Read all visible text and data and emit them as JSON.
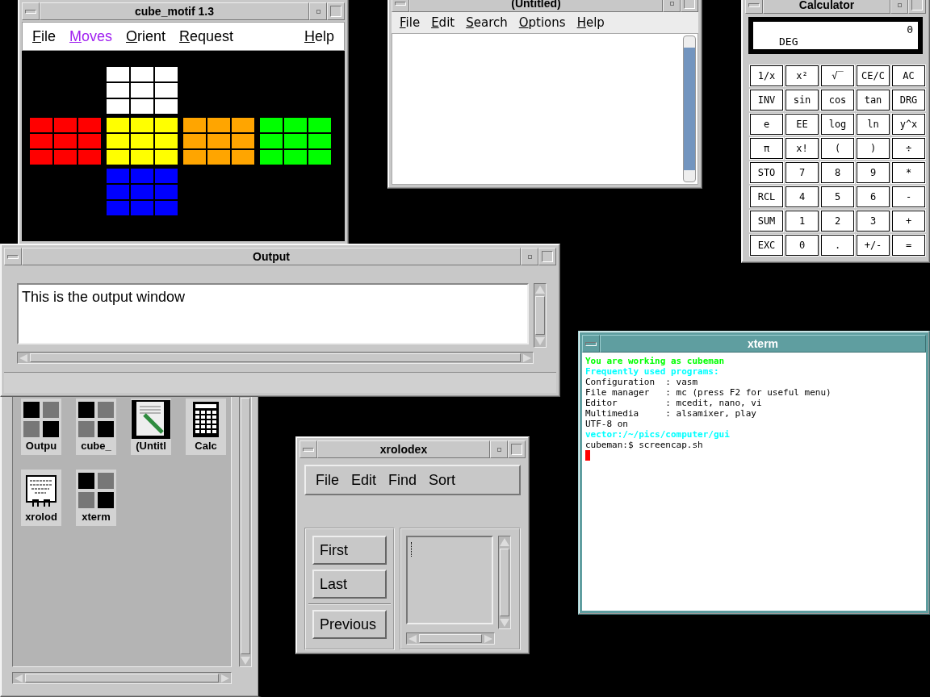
{
  "cube_window": {
    "title": "cube_motif 1.3",
    "menu": [
      {
        "label": "File",
        "selected": false
      },
      {
        "label": "Moves",
        "selected": true
      },
      {
        "label": "Orient",
        "selected": false
      },
      {
        "label": "Request",
        "selected": false
      },
      {
        "label": "Help",
        "selected": false
      }
    ],
    "faces": [
      {
        "color": "#ffffff"
      },
      {
        "color": "#ff0000"
      },
      {
        "color": "#ffff00"
      },
      {
        "color": "#ffa500"
      },
      {
        "color": "#00ff00"
      },
      {
        "color": "#0000ff"
      }
    ]
  },
  "editor_window": {
    "title": "(Untitled)",
    "menu": [
      "File",
      "Edit",
      "Search",
      "Options",
      "Help"
    ]
  },
  "calculator": {
    "title": "Calculator",
    "display": "0",
    "angle_mode": "DEG",
    "keys": [
      "1/x",
      "x²",
      "√‾",
      "CE/C",
      "AC",
      "INV",
      "sin",
      "cos",
      "tan",
      "DRG",
      "e",
      "EE",
      "log",
      "ln",
      "y^x",
      "π",
      "x!",
      "(",
      ")",
      "÷",
      "STO",
      "7",
      "8",
      "9",
      "*",
      "RCL",
      "4",
      "5",
      "6",
      "-",
      "SUM",
      "1",
      "2",
      "3",
      "+",
      "EXC",
      "0",
      ".",
      "+/-",
      "="
    ]
  },
  "output_window": {
    "title": "Output",
    "text": "This is the output window"
  },
  "icon_box": {
    "icons": [
      {
        "label": "Outpu",
        "kind": "window"
      },
      {
        "label": "cube_",
        "kind": "window"
      },
      {
        "label": "(Untitl",
        "kind": "editor"
      },
      {
        "label": "Calc",
        "kind": "calculator"
      },
      {
        "label": "xrolod",
        "kind": "rolodex"
      },
      {
        "label": "xterm",
        "kind": "window"
      }
    ]
  },
  "xterm": {
    "title": "xterm",
    "lines": [
      {
        "text": "You are working as cubeman",
        "color": "#00ff00",
        "kind": "banner"
      },
      {
        "text": "Frequently used programs:",
        "color": "#00ffff",
        "kind": "banner"
      },
      {
        "text": "Configuration  : vasm",
        "kind": "plain"
      },
      {
        "text": "File manager   : mc (press F2 for useful menu)",
        "kind": "plain"
      },
      {
        "text": "Editor         : mcedit, nano, vi",
        "kind": "plain"
      },
      {
        "text": "Multimedia     : alsamixer, play",
        "kind": "plain"
      },
      {
        "text": "UTF-8 on",
        "kind": "plain"
      },
      {
        "text": "vector:/~/pics/computer/gui",
        "color": "#00ffff",
        "kind": "banner"
      },
      {
        "text": "cubeman:$ screencap.sh",
        "kind": "plain"
      }
    ]
  },
  "xrolodex": {
    "title": "xrolodex",
    "menu": [
      "File",
      "Edit",
      "Find",
      "Sort"
    ],
    "buttons": [
      "First",
      "Last",
      "Previous"
    ]
  }
}
